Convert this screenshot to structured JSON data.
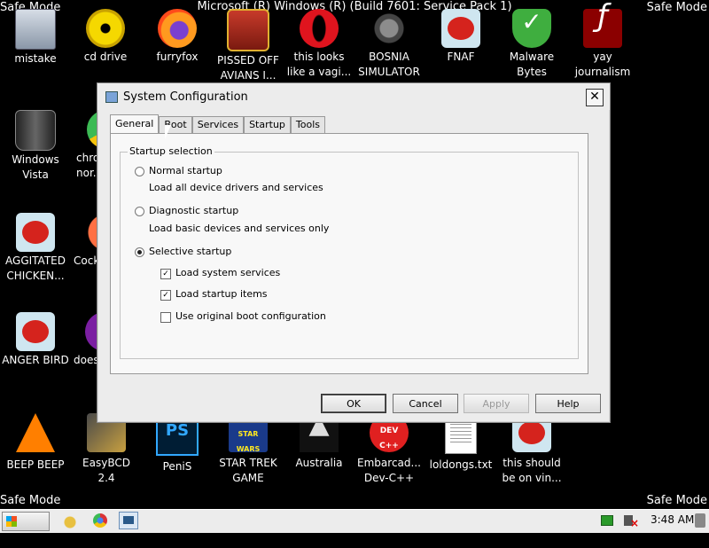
{
  "desktop": {
    "safe_mode_label": "Safe Mode",
    "build_text": "Microsoft (R) Windows (R) (Build 7601: Service Pack 1)",
    "icons": [
      {
        "label": "mistake",
        "icon": "computer-icon"
      },
      {
        "label": "cd drive",
        "icon": "cd-drive-icon"
      },
      {
        "label": "furryfox",
        "icon": "firefox-icon"
      },
      {
        "label": "PISSED OFF AVIANS I...",
        "icon": "angry-birds-seasons-icon"
      },
      {
        "label": "this looks like a vagi...",
        "icon": "opera-icon"
      },
      {
        "label": "BOSNIA SIMULATOR",
        "icon": "mace-icon"
      },
      {
        "label": "FNAF",
        "icon": "angry-bird-icon"
      },
      {
        "label": "Malware Bytes",
        "icon": "shield-icon"
      },
      {
        "label": "yay journalism",
        "icon": "flash-icon"
      },
      {
        "label": "Windows Vista",
        "icon": "recycle-bin-icon"
      },
      {
        "label": "chro... nor...",
        "icon": "chrome-icon"
      },
      {
        "label": "AGGITATED CHICKEN...",
        "icon": "angry-bird-icon"
      },
      {
        "label": "Cock...",
        "icon": "chrome-icon"
      },
      {
        "label": "ANGER BIRD",
        "icon": "angry-bird-icon"
      },
      {
        "label": "does...",
        "icon": "purple-app-icon"
      },
      {
        "label": "BEEP BEEP",
        "icon": "vlc-cone-icon"
      },
      {
        "label": "EasyBCD 2.4",
        "icon": "easybcd-icon"
      },
      {
        "label": "PeniS",
        "icon": "photoshop-icon"
      },
      {
        "label": "STAR TREK GAME",
        "icon": "star-wars-icon"
      },
      {
        "label": "Australia",
        "icon": "oz-icon"
      },
      {
        "label": "Embarcad... Dev-C++",
        "icon": "dev-cpp-icon"
      },
      {
        "label": "loldongs.txt",
        "icon": "text-file-icon"
      },
      {
        "label": "this should be on vin...",
        "icon": "angry-bird-icon"
      }
    ]
  },
  "dialog": {
    "title": "System Configuration",
    "close_label": "✕",
    "tabs": [
      "General",
      "Boot",
      "Services",
      "Startup",
      "Tools"
    ],
    "active_tab": "General",
    "group_label": "Startup selection",
    "options": [
      {
        "label": "Normal startup",
        "description": "Load all device drivers and services",
        "selected": false
      },
      {
        "label": "Diagnostic startup",
        "description": "Load basic devices and services only",
        "selected": false
      },
      {
        "label": "Selective startup",
        "selected": true
      }
    ],
    "checkboxes": [
      {
        "label": "Load system services",
        "checked": true
      },
      {
        "label": "Load startup items",
        "checked": true
      },
      {
        "label": "Use original boot configuration",
        "checked": false
      }
    ],
    "buttons": {
      "ok": "OK",
      "cancel": "Cancel",
      "apply": "Apply",
      "help": "Help"
    }
  },
  "taskbar": {
    "start_label": "Start",
    "clock": "3:48 AM"
  }
}
